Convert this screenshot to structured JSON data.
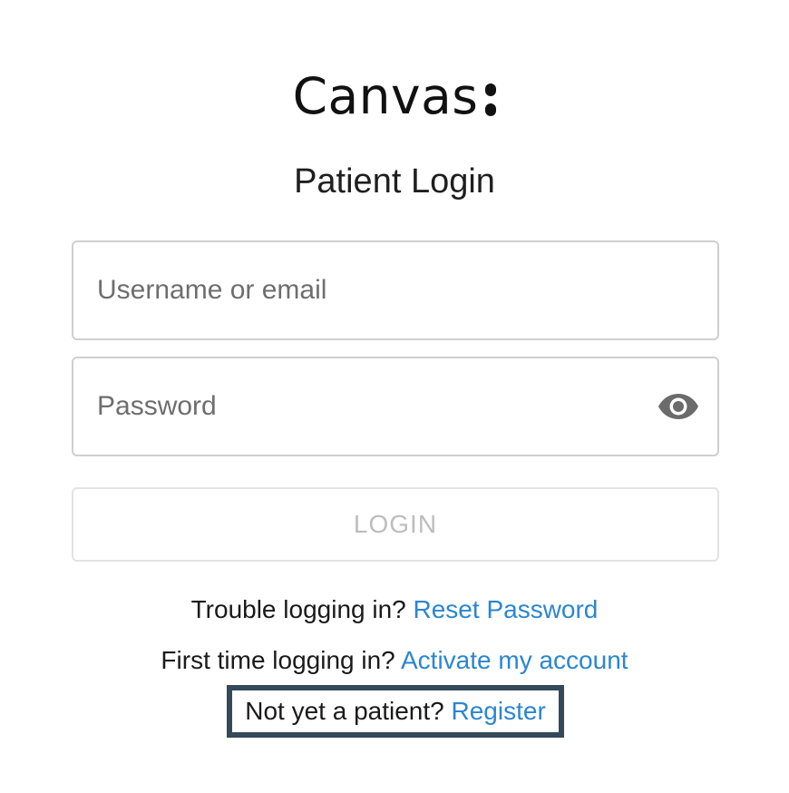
{
  "brand": {
    "logo_text": "Canvas"
  },
  "page_title": "Patient Login",
  "form": {
    "username_placeholder": "Username or email",
    "username_value": "",
    "password_placeholder": "Password",
    "password_value": "",
    "password_toggle_icon": "eye-icon",
    "login_label": "LOGIN"
  },
  "links": {
    "trouble_text": "Trouble logging in?",
    "reset_password": "Reset Password",
    "first_time_text": "First time logging in?",
    "activate_account": "Activate my account",
    "not_patient_text": "Not yet a patient?",
    "register": "Register"
  },
  "colors": {
    "link": "#2b86d1",
    "focus_outline": "#34495a",
    "disabled_text": "#bdbdbd"
  }
}
